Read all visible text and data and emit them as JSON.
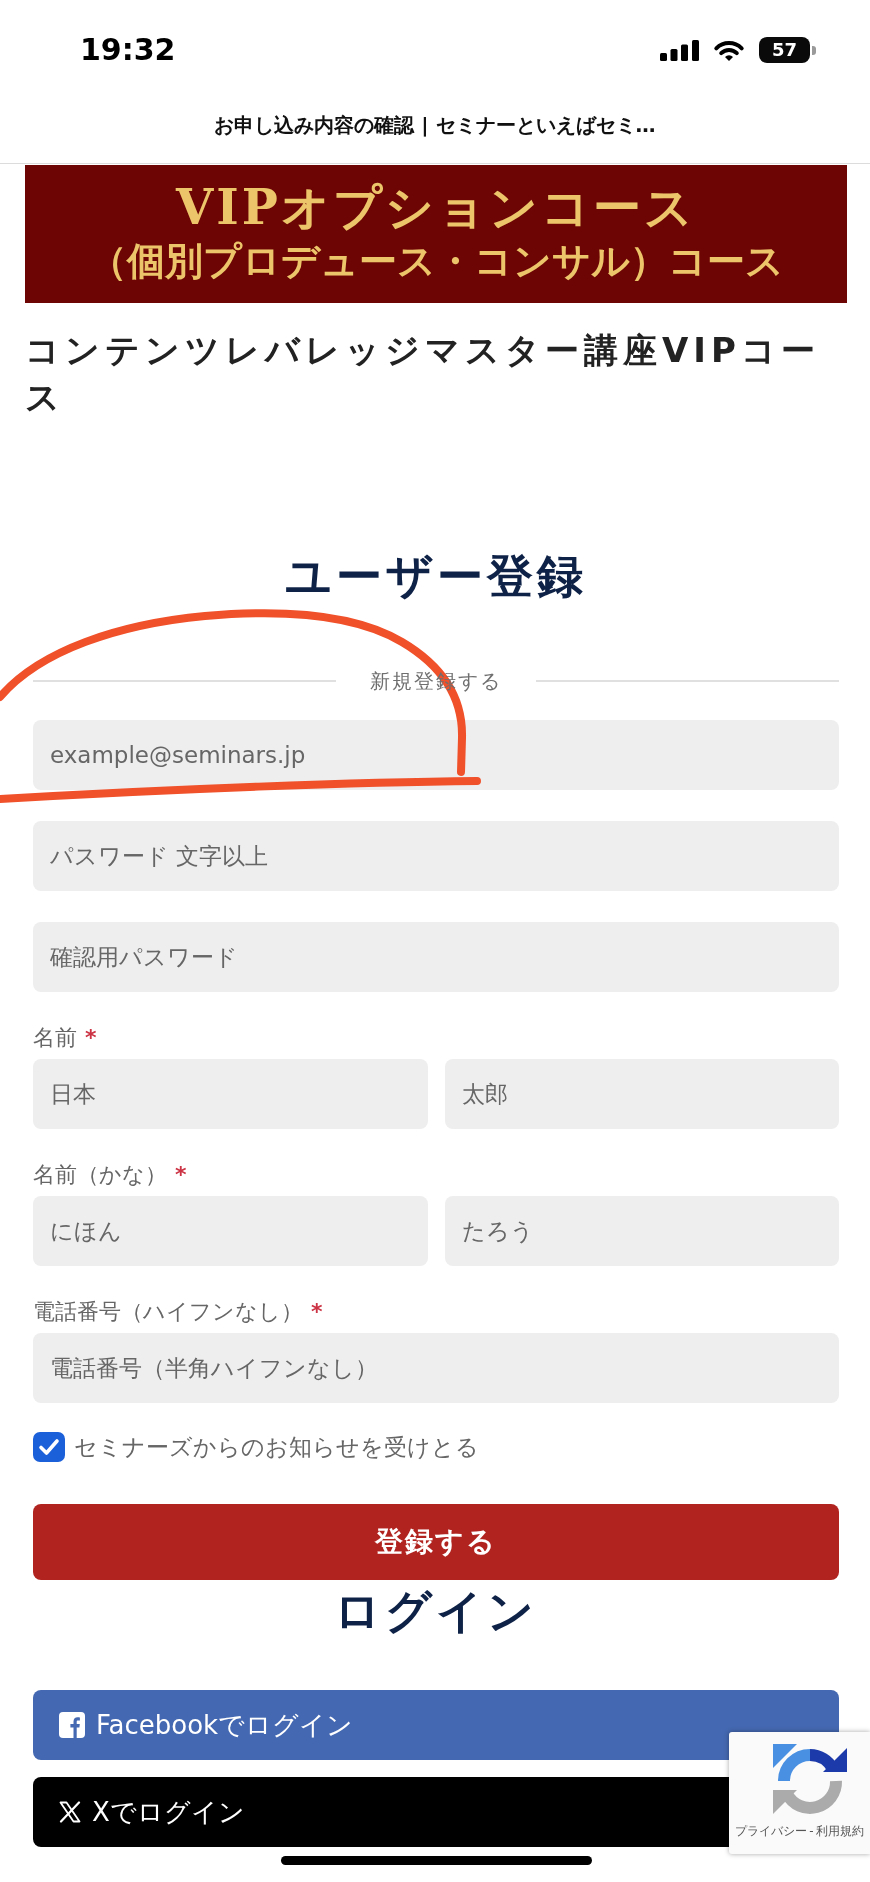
{
  "status_bar": {
    "time": "19:32",
    "battery": "57"
  },
  "page_title": "お申し込み内容の確認 | セミナーといえばセミ…",
  "banner": {
    "lines": [
      "VIPオプションコース",
      "（個別プロデュース・コンサル）コース"
    ]
  },
  "course_title": "コンテンツレバレッジマスター講座VIPコース",
  "register": {
    "heading": "ユーザー登録",
    "divider": "新規登録する",
    "groups": [
      {
        "inputs": [
          {
            "placeholder": "example@seminars.jp"
          }
        ]
      },
      {
        "inputs": [
          {
            "placeholder": "パスワード 文字以上"
          }
        ]
      },
      {
        "inputs": [
          {
            "placeholder": "確認用パスワード"
          }
        ]
      },
      {
        "label": "名前",
        "required_mark": "*",
        "inputs": [
          {
            "placeholder": "日本"
          },
          {
            "placeholder": "太郎"
          }
        ]
      },
      {
        "label": "名前（かな）",
        "required_mark": "*",
        "inputs": [
          {
            "placeholder": "にほん"
          },
          {
            "placeholder": "たろう"
          }
        ]
      },
      {
        "label": "電話番号（ハイフンなし）",
        "required_mark": "*",
        "inputs": [
          {
            "placeholder": "電話番号（半角ハイフンなし）"
          }
        ]
      }
    ],
    "consent": {
      "label": "セミナーズからのお知らせを受けとる",
      "checked": true
    },
    "submit": "登録する"
  },
  "login": {
    "heading": "ログイン",
    "buttons": [
      {
        "kind": "facebook",
        "label": "Facebookでログイン"
      },
      {
        "kind": "x",
        "label": "Xでログイン"
      }
    ]
  },
  "captcha": {
    "privacy": "プライバシー",
    "separator": "-",
    "terms": "利用規約"
  }
}
